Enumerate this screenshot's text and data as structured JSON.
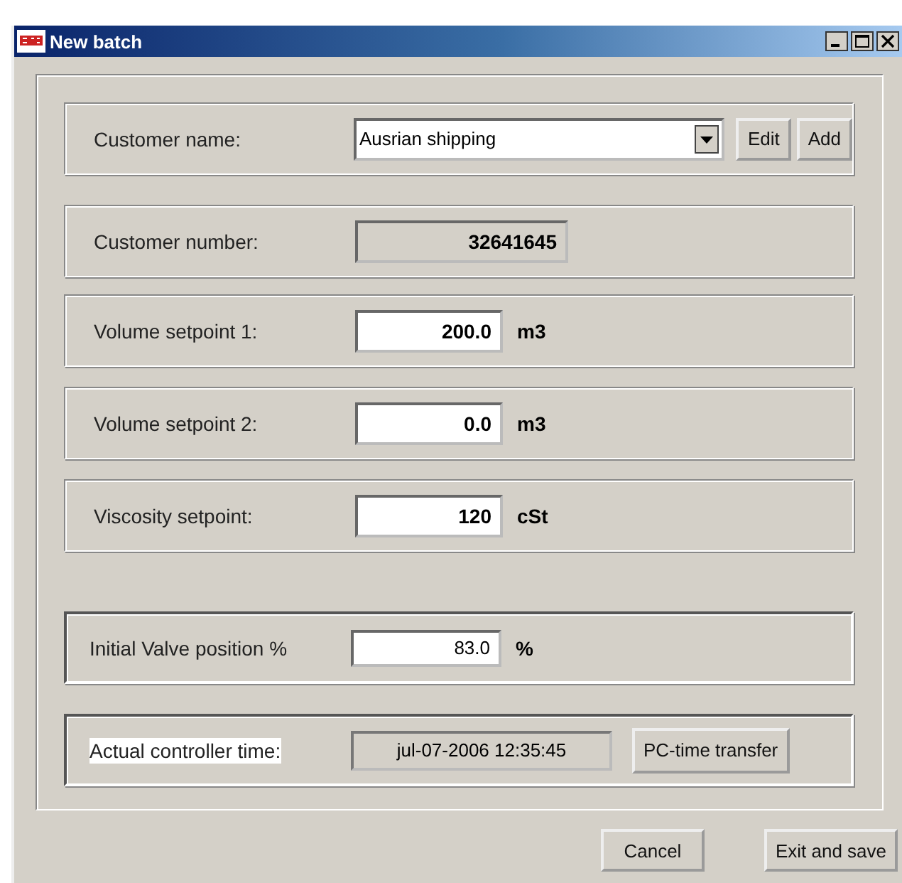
{
  "window": {
    "title": "New batch"
  },
  "rows": [
    {
      "kind": "combo",
      "label": "Customer name:",
      "value": "Ausrian shipping",
      "buttons": [
        "Edit",
        "Add"
      ]
    },
    {
      "kind": "readonly",
      "label": "Customer number:",
      "value": "32641645"
    },
    {
      "kind": "input",
      "label": "Volume setpoint 1:",
      "value": "200.0",
      "unit": "m3"
    },
    {
      "kind": "input",
      "label": "Volume setpoint 2:",
      "value": "0.0",
      "unit": "m3"
    },
    {
      "kind": "input",
      "label": "Viscosity setpoint:",
      "value": "120",
      "unit": "cSt"
    },
    {
      "kind": "valve",
      "label": "Initial Valve position %",
      "value": "83.0",
      "unit": "%"
    },
    {
      "kind": "time",
      "label": "Actual controller time:",
      "value": "jul-07-2006 12:35:45",
      "buttons": [
        "PC-time transfer"
      ]
    }
  ],
  "buttons": [
    "Cancel",
    "Exit and save"
  ]
}
